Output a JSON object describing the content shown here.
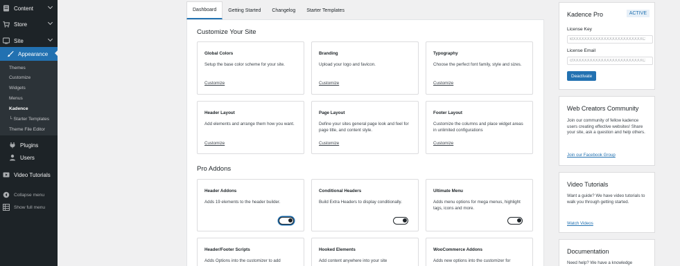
{
  "sidebar": {
    "items": [
      {
        "label": "Content",
        "icon": "content-icon"
      },
      {
        "label": "Store",
        "icon": "store-icon"
      },
      {
        "label": "Site",
        "icon": "site-icon"
      },
      {
        "label": "Appearance",
        "icon": "paintbrush-icon"
      }
    ],
    "submenu": [
      "Themes",
      "Customize",
      "Widgets",
      "Menus",
      "Kadence",
      "└ Starter Templates",
      "Theme File Editor"
    ],
    "lower_items": [
      {
        "label": "Plugins",
        "icon": "plugins-icon"
      },
      {
        "label": "Users",
        "icon": "users-icon"
      },
      {
        "label": "Video Tutorials",
        "icon": "video-icon"
      }
    ],
    "collapse_label": "Collapse menu",
    "full_menu_label": "Show full menu"
  },
  "tabs": [
    "Dashboard",
    "Getting Started",
    "Changelog",
    "Starter Templates"
  ],
  "customize": {
    "title": "Customize Your Site",
    "cards": [
      {
        "title": "Global Colors",
        "desc": "Setup the base color scheme for your site.",
        "link": "Customize"
      },
      {
        "title": "Branding",
        "desc": "Upload your logo and favicon.",
        "link": "Customize"
      },
      {
        "title": "Typography",
        "desc": "Choose the perfect font family, style and sizes.",
        "link": "Customize"
      },
      {
        "title": "Header Layout",
        "desc": "Add elements and arrange them how you want.",
        "link": "Customize"
      },
      {
        "title": "Page Layout",
        "desc": "Define your sites general page look and feel for page title, and content style.",
        "link": "Customize"
      },
      {
        "title": "Footer Layout",
        "desc": "Customize the columns and place widget areas in unlimited configurations",
        "link": "Customize"
      }
    ]
  },
  "addons": {
    "title": "Pro Addons",
    "cards": [
      {
        "title": "Header Addons",
        "desc": "Adds 19 elements to the header builder."
      },
      {
        "title": "Conditional Headers",
        "desc": "Build Extra Headers to display conditionally."
      },
      {
        "title": "Ultimate Menu",
        "desc": "Adds menu options for mega menus, highlight tags, icons and more."
      },
      {
        "title": "Header/Footer Scripts",
        "desc": "Adds Options into the customizer to add"
      },
      {
        "title": "Hooked Elements",
        "desc": "Add content anywhere into your site"
      },
      {
        "title": "WooCommerce Addons",
        "desc": "Adds new options into the customizer for"
      }
    ]
  },
  "license": {
    "title": "Kadence Pro",
    "status": "ACTIVE",
    "key_label": "License Key",
    "key_value": "ktXXXXXXXXXXXXXXXXXXXXXXXXXC",
    "email_label": "License Email",
    "email_value": "cfXXXXXXXXXXXXXXXXXXXXXXXXXC",
    "button": "Deactivate"
  },
  "community": {
    "title": "Web Creators Community",
    "text": "Join our community of fellow kadence users creating effective websites! Share your site, ask a question and help others.",
    "link": "Join our Facebook Group"
  },
  "videos": {
    "title": "Video Tutorials",
    "text": "Want a guide? We have video tutorials to walk you through getting started.",
    "link": "Watch Videos"
  },
  "docs": {
    "title": "Documentation",
    "text": "Need help? We have a knowledge"
  },
  "colors": {
    "sidebar": "#1d2327",
    "accent": "#2271b1",
    "background": "#f0f0f1"
  }
}
